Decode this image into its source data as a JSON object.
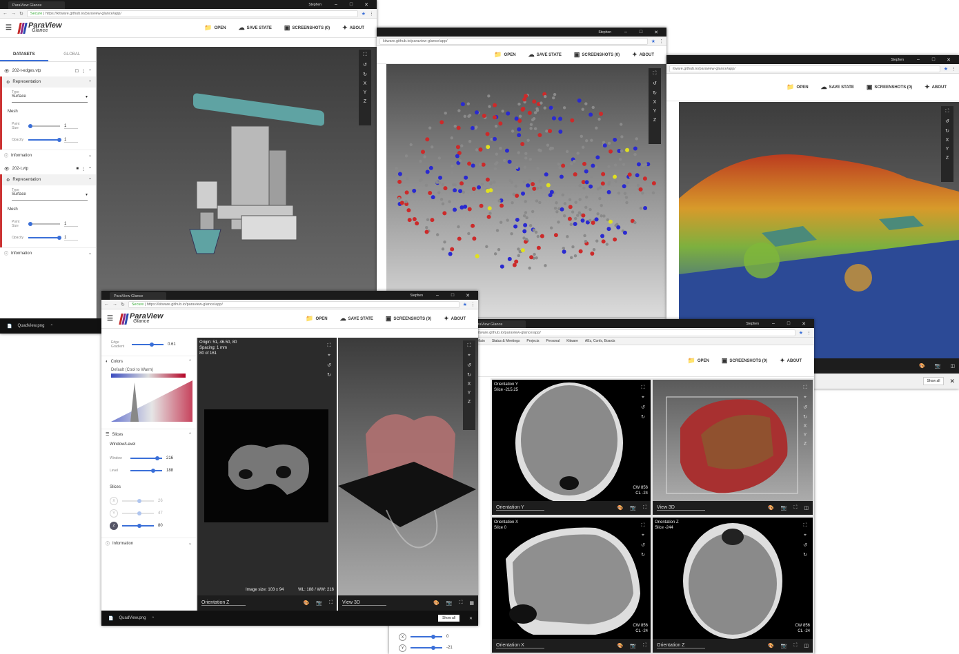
{
  "user": "Stephen",
  "tab_title": "ParaView Glance",
  "url": "https://kitware.github.io/paraview-glance/app/",
  "url_short": "kitware.github.io/paraview-glance/app/",
  "url_short2": "itware.github.io/paraview-glance/app/",
  "secure_label": "Secure",
  "logo": {
    "main": "ParaView",
    "sub": "Glance"
  },
  "toolbar": {
    "open": "OPEN",
    "save_state": "SAVE STATE",
    "screenshots": "SCREENSHOTS (0)",
    "about": "ABOUT"
  },
  "bookmarks": [
    "Main",
    "Status & Meetings",
    "Projects",
    "Personal",
    "Kitware",
    "AEs, Confs, Boards"
  ],
  "vtools": [
    "X",
    "Y",
    "Z"
  ],
  "win1": {
    "tabs": [
      "DATASETS",
      "GLOBAL"
    ],
    "datasets": [
      {
        "name": "202-t-edges.vtp",
        "section": "Representation",
        "type_label": "Type",
        "type_value": "Surface",
        "mesh": "Mesh",
        "point_size_label": "Point Size",
        "point_size": "1",
        "opacity_label": "Opacity",
        "opacity": "1",
        "info": "Information"
      },
      {
        "name": "202-t.vtp",
        "section": "Representation",
        "type_label": "Type",
        "type_value": "Surface",
        "mesh": "Mesh",
        "point_size_label": "Point Size",
        "point_size": "1",
        "opacity_label": "Opacity",
        "opacity": "1",
        "info": "Information"
      }
    ],
    "taskbar_file": "QuadView.png"
  },
  "win4": {
    "edge_label": "Edge Gradient",
    "edge_value": "0.61",
    "colors": "Colors",
    "colormap": "Default (Cool to Warm)",
    "slices": "Slices",
    "window_level": "Window/Level",
    "window_label": "Window",
    "window_value": "216",
    "level_label": "Level",
    "level_value": "188",
    "slices_label": "Slices",
    "slice_rows": [
      {
        "axis": "X",
        "value": "26"
      },
      {
        "axis": "Y",
        "value": "47"
      },
      {
        "axis": "Z",
        "value": "80"
      }
    ],
    "information": "Information",
    "overlay": {
      "origin": "Origin: 51, 46.50, 80",
      "spacing": "Spacing: 1 mm",
      "slice": "80 of 161"
    },
    "image_size": "Image size: 103 x 94",
    "wlww": "WL: 188 / WW: 216",
    "left_view": "Orientation Z",
    "right_view": "View 3D",
    "taskbar_file": "QuadView.png",
    "show_all": "Show all"
  },
  "win5": {
    "q1": {
      "title": "Orientation Y",
      "slice": "Slice -215.25",
      "cw": "CW 856",
      "cl": "CL -24",
      "sel": "Orientation Y"
    },
    "q2": {
      "sel": "View 3D"
    },
    "q3": {
      "title": "Orientation X",
      "slice": "Slice 0",
      "cw": "CW 856",
      "cl": "CL -24",
      "sel": "Orientation X"
    },
    "q4": {
      "title": "Orientation Z",
      "slice": "Slice -244",
      "cw": "CW 856",
      "cl": "CL -24",
      "sel": "Orientation Z"
    },
    "bottom_values": [
      "0",
      "-21"
    ]
  },
  "win3": {
    "show_all": "Show all"
  }
}
